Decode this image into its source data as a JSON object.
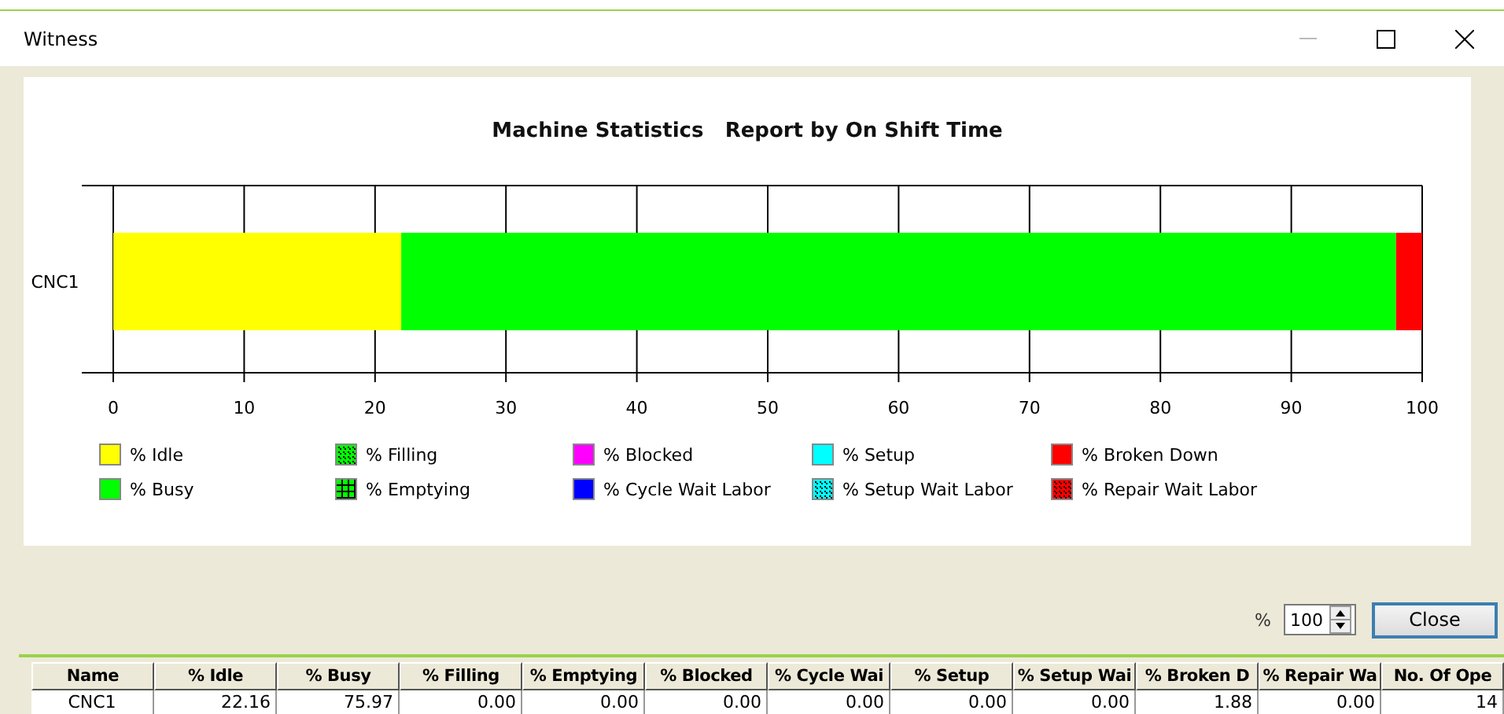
{
  "window": {
    "title": "Witness"
  },
  "chart": {
    "title": "Machine Statistics   Report by On Shift Time",
    "chart_data": {
      "type": "bar",
      "orientation": "horizontal",
      "stacked": true,
      "grid": true,
      "categories": [
        "CNC1"
      ],
      "xlim": [
        0,
        100
      ],
      "xticks": [
        0,
        10,
        20,
        30,
        40,
        50,
        60,
        70,
        80,
        90,
        100
      ],
      "series": [
        {
          "name": "% Idle",
          "color": "#ffff00",
          "values": [
            22
          ]
        },
        {
          "name": "% Busy",
          "color": "#00ff00",
          "values": [
            76
          ]
        },
        {
          "name": "% Filling",
          "color": "#00ff00",
          "values": [
            0
          ]
        },
        {
          "name": "% Emptying",
          "color": "#00ff00",
          "values": [
            0
          ]
        },
        {
          "name": "% Blocked",
          "color": "#ff00ff",
          "values": [
            0
          ]
        },
        {
          "name": "% Cycle Wait Labor",
          "color": "#0000ff",
          "values": [
            0
          ]
        },
        {
          "name": "% Setup",
          "color": "#00ffff",
          "values": [
            0
          ]
        },
        {
          "name": "% Setup Wait Labor",
          "color": "#00ffff",
          "values": [
            0
          ]
        },
        {
          "name": "% Broken Down",
          "color": "#ff0000",
          "values": [
            2
          ]
        },
        {
          "name": "% Repair Wait Labor",
          "color": "#ff0000",
          "values": [
            0
          ]
        }
      ]
    },
    "legend": [
      {
        "kind": "solid"
      },
      {
        "kind": "solid"
      },
      {
        "kind": "dots"
      },
      {
        "kind": "grid"
      },
      {
        "kind": "solid"
      },
      {
        "kind": "solid"
      },
      {
        "kind": "solid"
      },
      {
        "kind": "dots"
      },
      {
        "kind": "solid"
      },
      {
        "kind": "dots"
      }
    ]
  },
  "zoom": {
    "label": "%",
    "value": "100"
  },
  "close_button": "Close",
  "table": {
    "columns": [
      "Name",
      "% Idle",
      "% Busy",
      "% Filling",
      "% Emptying",
      "% Blocked",
      "% Cycle Wai",
      "% Setup",
      "% Setup Wai",
      "% Broken D",
      "% Repair Wa",
      "No. Of Ope"
    ],
    "rows": [
      [
        "CNC1",
        "22.16",
        "75.97",
        "0.00",
        "0.00",
        "0.00",
        "0.00",
        "0.00",
        "0.00",
        "1.88",
        "0.00",
        "14"
      ]
    ]
  }
}
